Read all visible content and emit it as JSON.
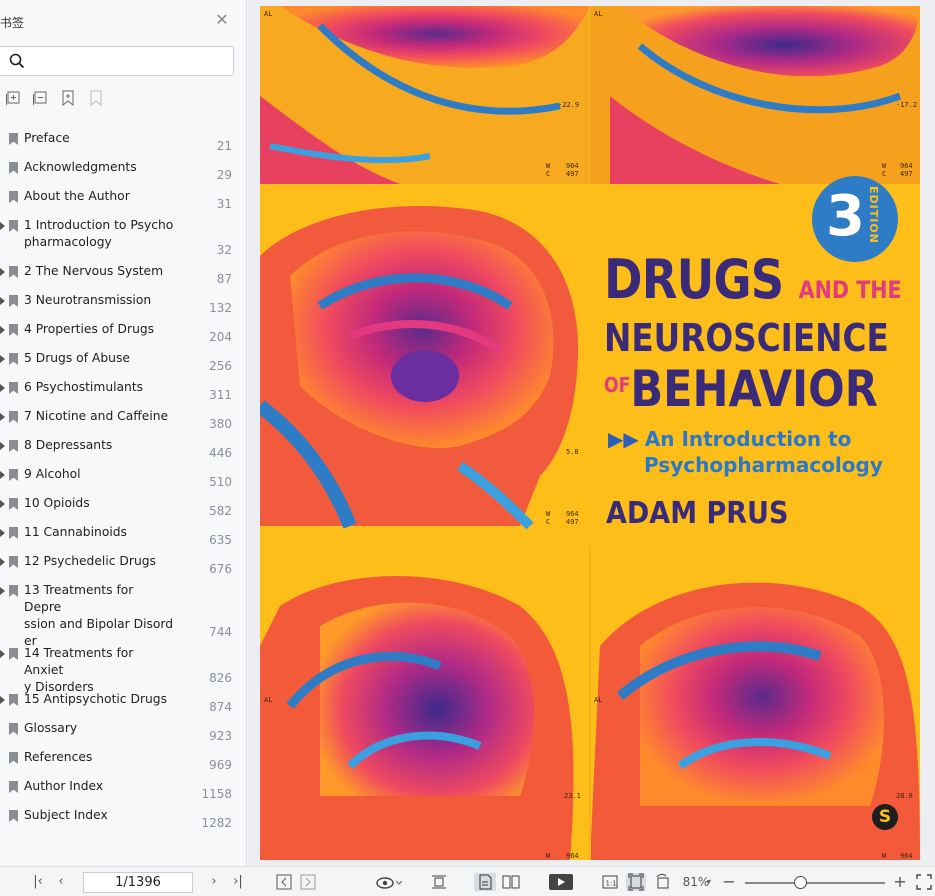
{
  "sidebar": {
    "title": "书签",
    "search": {
      "placeholder": ""
    },
    "bookmarks": [
      {
        "label": "Preface",
        "page": "21",
        "expandable": false
      },
      {
        "label": "Acknowledgments",
        "page": "29",
        "expandable": false
      },
      {
        "label": "About the Author",
        "page": "31",
        "expandable": false
      },
      {
        "label": "1 Introduction to Psycho\npharmacology",
        "page": "32",
        "expandable": true
      },
      {
        "label": "2 The Nervous System",
        "page": "87",
        "expandable": true
      },
      {
        "label": "3 Neurotransmission",
        "page": "132",
        "expandable": true
      },
      {
        "label": "4 Properties of Drugs",
        "page": "204",
        "expandable": true
      },
      {
        "label": "5 Drugs of Abuse",
        "page": "256",
        "expandable": true
      },
      {
        "label": "6 Psychostimulants",
        "page": "311",
        "expandable": true
      },
      {
        "label": "7 Nicotine and Caffeine",
        "page": "380",
        "expandable": true
      },
      {
        "label": "8 Depressants",
        "page": "446",
        "expandable": true
      },
      {
        "label": "9 Alcohol",
        "page": "510",
        "expandable": true
      },
      {
        "label": "10 Opioids",
        "page": "582",
        "expandable": true
      },
      {
        "label": "11 Cannabinoids",
        "page": "635",
        "expandable": true
      },
      {
        "label": "12 Psychedelic Drugs",
        "page": "676",
        "expandable": true
      },
      {
        "label": "13 Treatments for Depre\nssion and Bipolar Disord\ner",
        "page": "744",
        "expandable": true
      },
      {
        "label": "14 Treatments for Anxiet\ny Disorders",
        "page": "826",
        "expandable": true
      },
      {
        "label": "15 Antipsychotic Drugs",
        "page": "874",
        "expandable": true
      },
      {
        "label": "Glossary",
        "page": "923",
        "expandable": false
      },
      {
        "label": "References",
        "page": "969",
        "expandable": false
      },
      {
        "label": "Author Index",
        "page": "1158",
        "expandable": false
      },
      {
        "label": "Subject Index",
        "page": "1282",
        "expandable": false
      }
    ]
  },
  "cover": {
    "title_line1": "DRUGS",
    "title_and_the": "AND THE",
    "title_line2": "NEUROSCIENCE",
    "title_of": "OF",
    "title_line3": "BEHAVIOR",
    "subtitle_line1": "An Introduction to",
    "subtitle_line2": "Psychopharmacology",
    "author": "ADAM PRUS",
    "edition_number": "3",
    "edition_word": "EDITION",
    "publisher_mark": "S",
    "scan_labels": {
      "al_top_left": "AL",
      "al_top_right": "AL",
      "val_tl": "-22.9",
      "val_tr": "-17.2",
      "wc_tl": "W\nC",
      "wc_tl_vals": "964\n497",
      "wc_tr_vals": "964\n497",
      "wc_tr": "W\nC",
      "val_mid": "5.8",
      "wc_mid": "W\nC",
      "wc_mid_vals": "964\n497",
      "al_bl": "AL",
      "al_br": "AL",
      "val_bl": "23.1",
      "val_br": "28.8",
      "w_bl": "W",
      "w_bl_val": "964",
      "w_br": "W",
      "w_br_val": "964"
    },
    "colors": {
      "background": "#fdbe1a",
      "title": "#3a2a7a",
      "accent_pink": "#e33a7f",
      "accent_blue": "#2f7cc6"
    }
  },
  "toolbar": {
    "page_display": "1/1396",
    "zoom": "81%",
    "icons": [
      "first-page-icon",
      "prev-page-icon",
      "next-page-icon",
      "last-page-icon",
      "back-icon",
      "forward-icon",
      "read-mode-icon",
      "fit-width-icon",
      "single-page-icon",
      "two-page-icon",
      "play-icon",
      "actual-size-icon",
      "fit-page-icon",
      "rotate-icon",
      "zoom-out-icon",
      "zoom-in-icon",
      "fullscreen-icon"
    ]
  }
}
